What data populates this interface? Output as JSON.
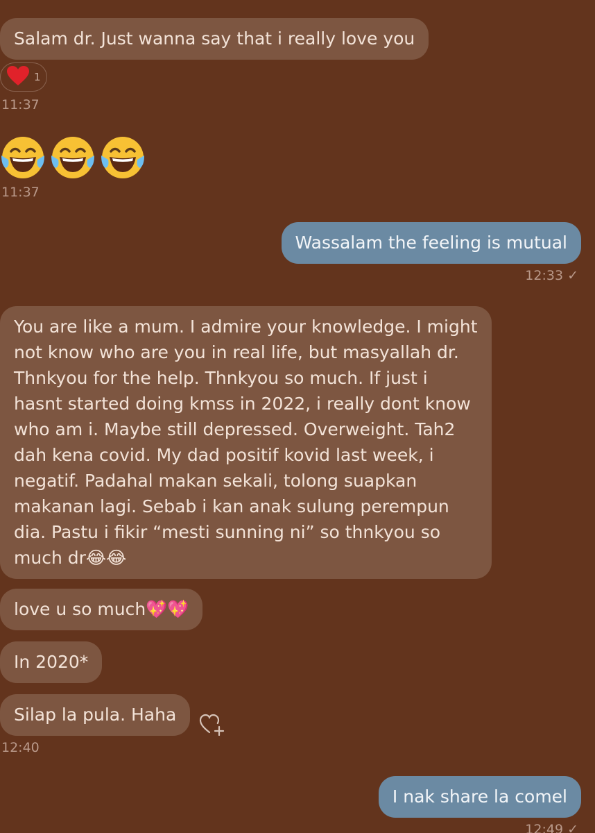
{
  "messages": [
    {
      "text": "Salam dr. Just wanna say that i really love you"
    },
    {
      "text": "Wassalam the feeling is mutual"
    },
    {
      "text": "You are like a mum. I admire your knowledge. I might\nnot know who are you in real life, but masyallah dr.\nThnkyou for the help. Thnkyou so much. If just i\nhasnt started doing kmss in 2022, i really dont know\nwho am i. Maybe still depressed. Overweight. Tah2\ndah kena covid. My dad positif kovid last week, i\nnegatif. Padahal makan sekali, tolong suapkan\nmakanan lagi. Sebab i kan anak sulung perempun\ndia. Pastu i fikir “mesti sunning ni” so thnkyou so\nmuch dr😂😂"
    },
    {
      "text": "love u so much💖💖"
    },
    {
      "text": "In 2020*"
    },
    {
      "text": "Silap la pula. Haha"
    },
    {
      "text": "I nak share la comel"
    }
  ],
  "reaction": {
    "icon": "red-heart-icon",
    "count": "1"
  },
  "emoji_message": {
    "icons": [
      "laughing-tears-icon",
      "laughing-tears-icon",
      "laughing-tears-icon"
    ]
  },
  "times": {
    "t1": "11:37",
    "t2": "11:37",
    "t3": "12:33 ✓",
    "t4": "12:40",
    "t5": "12:49 ✓"
  },
  "colors": {
    "background": "#63341d",
    "incoming_bubble": "#7d5641",
    "outgoing_bubble": "#6b8aa3"
  }
}
